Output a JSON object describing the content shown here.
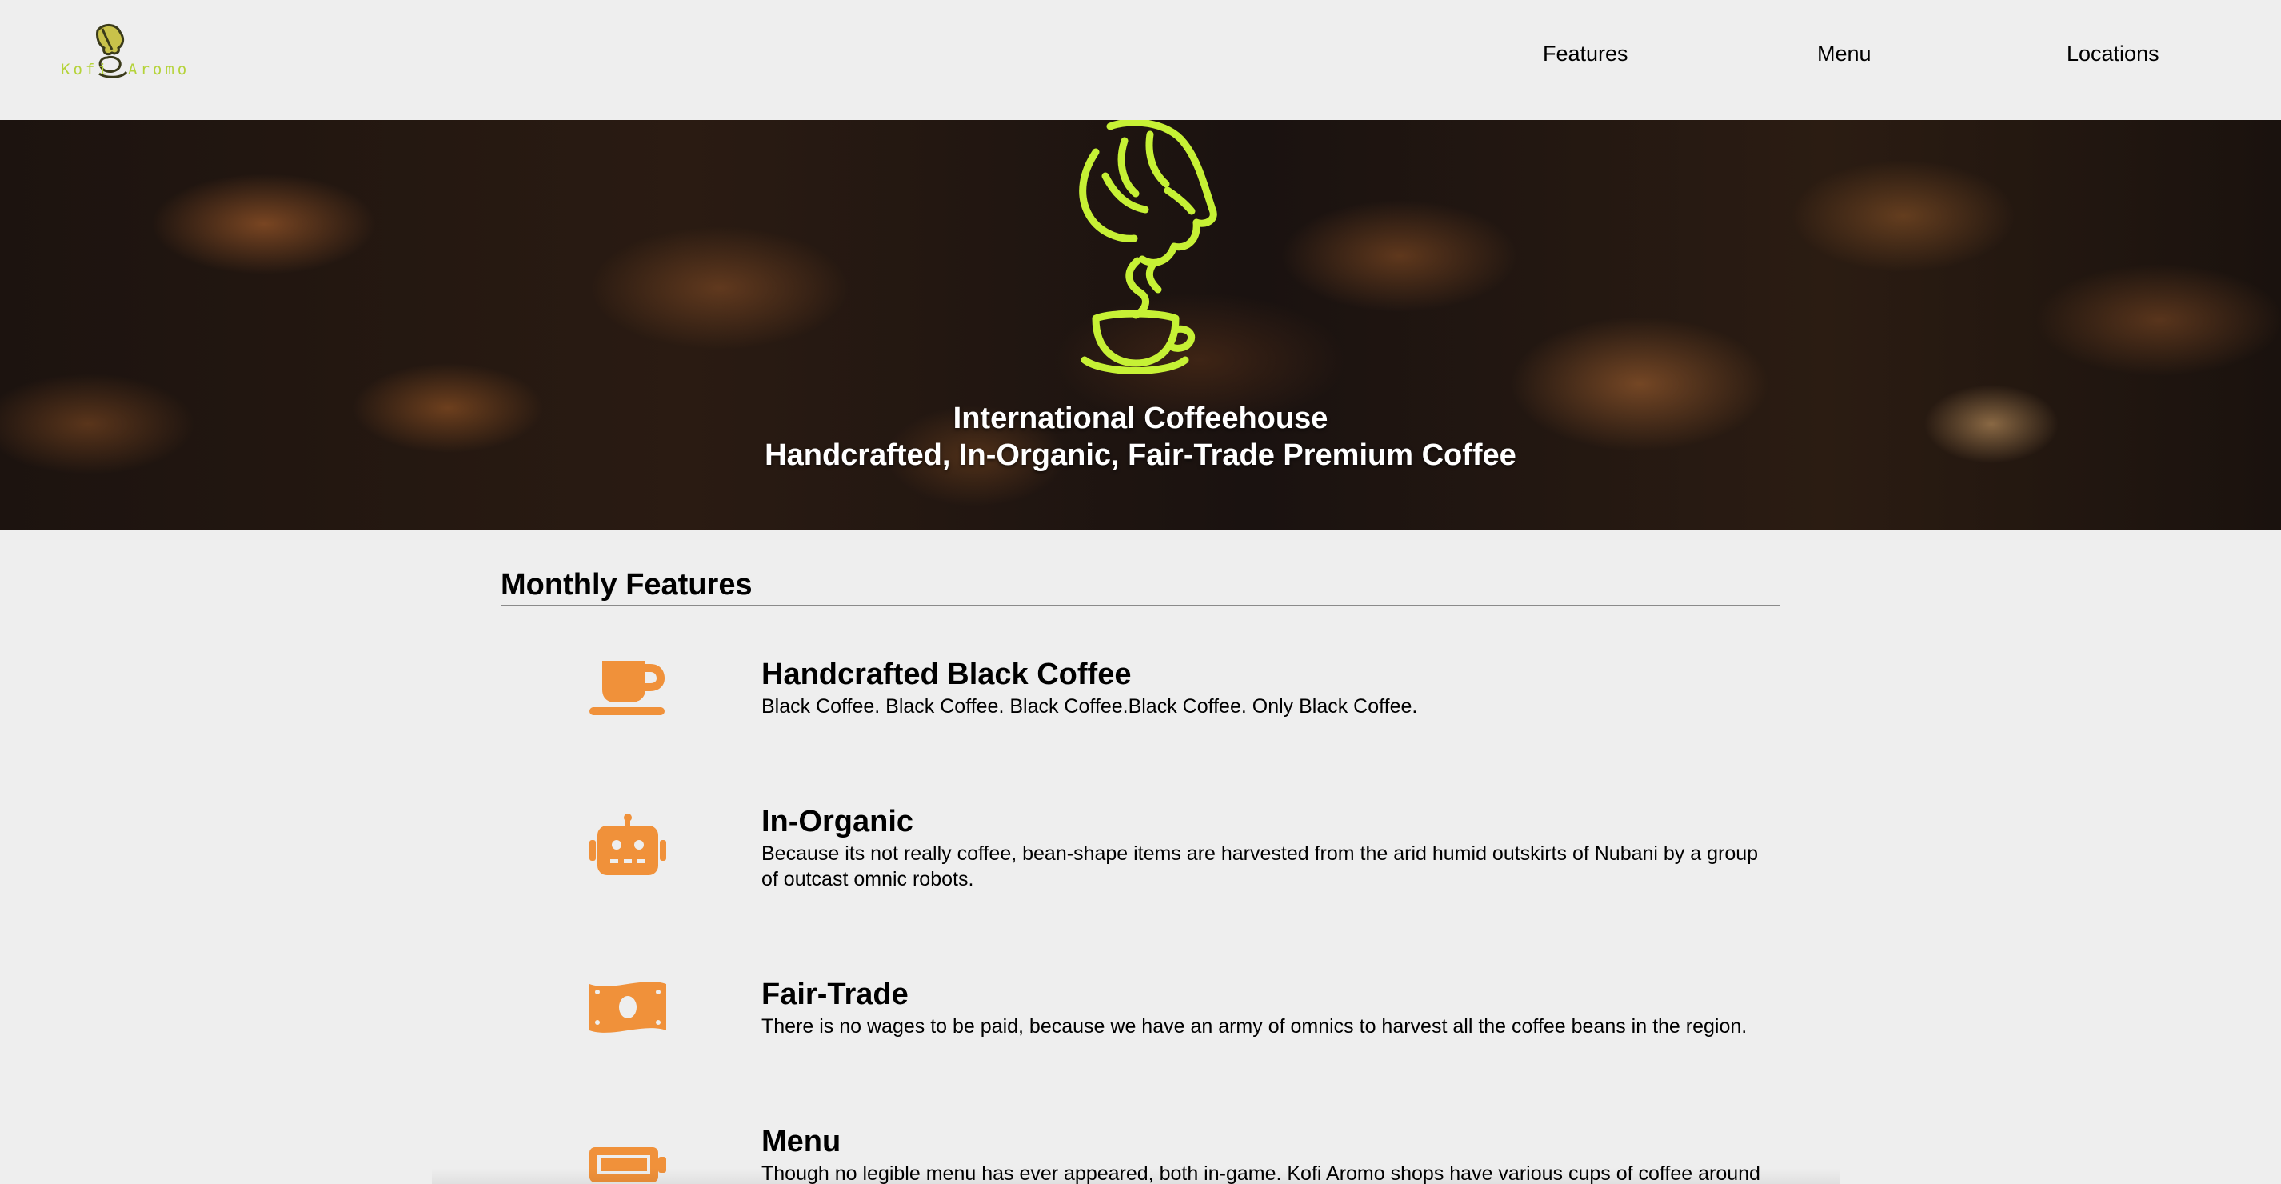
{
  "header": {
    "logo": {
      "text_left": "Kofi",
      "text_right": "Aromo",
      "color": "#b5d33a"
    },
    "nav": [
      {
        "label": "Features"
      },
      {
        "label": "Menu"
      },
      {
        "label": "Locations"
      }
    ]
  },
  "hero": {
    "logo_color": "#c6f135",
    "title": "International Coffeehouse",
    "subtitle": "Handcrafted, In-Organic, Fair-Trade Premium Coffee"
  },
  "features": {
    "heading": "Monthly Features",
    "accent_color": "#f0913a",
    "items": [
      {
        "icon": "coffee-cup-icon",
        "title": "Handcrafted Black Coffee",
        "description": "Black Coffee. Black Coffee. Black Coffee.Black Coffee. Only Black Coffee."
      },
      {
        "icon": "robot-icon",
        "title": "In-Organic",
        "description": "Because its not really coffee, bean-shape items are harvested from the arid humid outskirts of Nubani by a group of outcast omnic robots."
      },
      {
        "icon": "money-icon",
        "title": "Fair-Trade",
        "description": "There is no wages to be paid, because we have an army of omnics to harvest all the coffee beans in the region."
      },
      {
        "icon": "battery-icon",
        "title": "Menu",
        "description": "Though no legible menu has ever appeared, both in-game. Kofi Aromo shops have various cups of coffee around"
      }
    ]
  }
}
